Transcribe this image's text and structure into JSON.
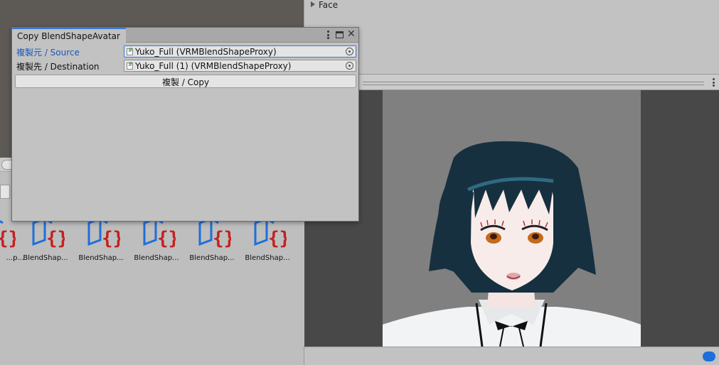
{
  "inspector": {
    "face_label": "Face"
  },
  "window": {
    "title": "Copy BlendShapeAvatar",
    "source_label": "複製元 / Source",
    "source_value": "Yuko_Full (VRMBlendShapeProxy)",
    "destination_label": "複製先 / Destination",
    "destination_value": "Yuko_Full (1) (VRMBlendShapeProxy)",
    "copy_button": "複製 / Copy"
  },
  "assets": [
    {
      "label": "...p..."
    },
    {
      "label": "BlendShap..."
    },
    {
      "label": "BlendShap..."
    },
    {
      "label": "BlendShap..."
    },
    {
      "label": "BlendShap..."
    },
    {
      "label": "BlendShap..."
    }
  ],
  "colors": {
    "accent": "#3a79d6",
    "asset_blue": "#1e6fd9",
    "asset_red": "#c42020"
  },
  "icons": {
    "asset": "blendshape-asset-icon",
    "object_field": "script-icon",
    "picker": "object-picker-icon",
    "tag": "tag-icon"
  }
}
